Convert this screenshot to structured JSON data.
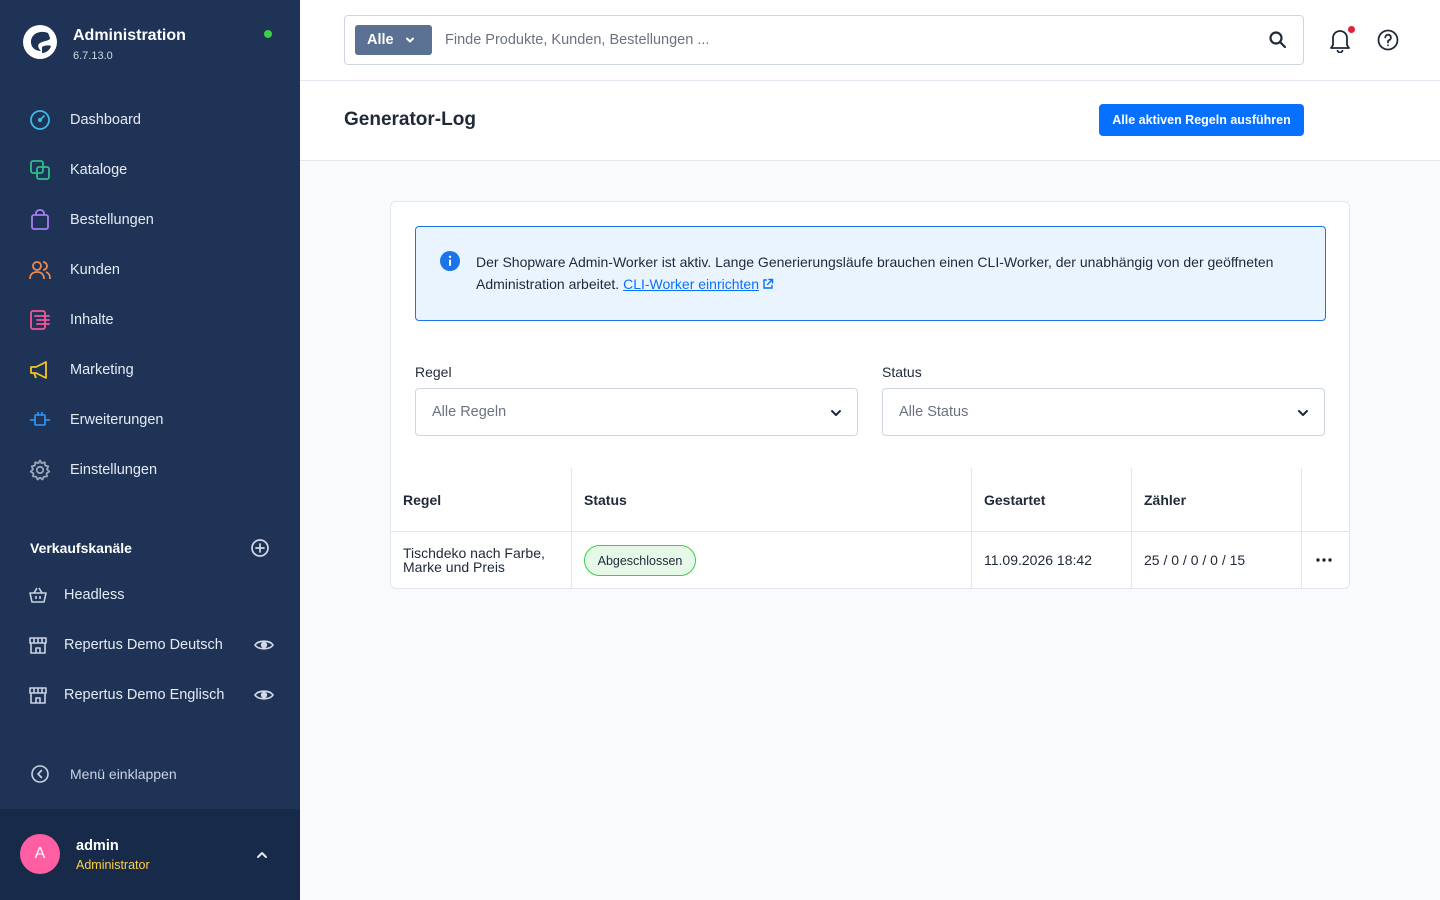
{
  "brand": {
    "title": "Administration",
    "version": "6.7.13.0"
  },
  "nav": [
    {
      "label": "Dashboard",
      "icon": "dashboard-icon",
      "color": "#3fb8e0"
    },
    {
      "label": "Kataloge",
      "icon": "catalog-icon",
      "color": "#2ebf8a"
    },
    {
      "label": "Bestellungen",
      "icon": "shopping-bag-icon",
      "color": "#a57ef0"
    },
    {
      "label": "Kunden",
      "icon": "customers-icon",
      "color": "#f08a4b"
    },
    {
      "label": "Inhalte",
      "icon": "content-icon",
      "color": "#f0589a"
    },
    {
      "label": "Marketing",
      "icon": "megaphone-icon",
      "color": "#f5c61a"
    },
    {
      "label": "Erweiterungen",
      "icon": "plug-icon",
      "color": "#2f8fe8"
    },
    {
      "label": "Einstellungen",
      "icon": "gear-icon",
      "color": "#9aa7b8"
    }
  ],
  "sales_channels": {
    "title": "Verkaufskanäle",
    "items": [
      {
        "label": "Headless",
        "icon": "basket-icon"
      },
      {
        "label": "Repertus Demo Deutsch",
        "icon": "storefront-icon"
      },
      {
        "label": "Repertus Demo Englisch",
        "icon": "storefront-icon"
      }
    ]
  },
  "collapse_label": "Menü einklappen",
  "user": {
    "initial": "A",
    "name": "admin",
    "role": "Administrator"
  },
  "search": {
    "type": "Alle",
    "placeholder": "Finde Produkte, Kunden, Bestellungen ..."
  },
  "page": {
    "title": "Generator-Log",
    "action_label": "Alle aktiven Regeln ausführen"
  },
  "alert": {
    "text": "Der Shopware Admin-Worker ist aktiv. Lange Generierungsläufe brauchen einen CLI-Worker, der unabhängig von der geöffneten Administration arbeitet.",
    "link": "CLI-Worker einrichten"
  },
  "filters": {
    "rule": {
      "label": "Regel",
      "value": "Alle Regeln"
    },
    "status": {
      "label": "Status",
      "value": "Alle Status"
    }
  },
  "table": {
    "columns": [
      "Regel",
      "Status",
      "Gestartet",
      "Zähler"
    ],
    "rows": [
      {
        "rule": "Tischdeko nach Farbe, Marke und Preis",
        "status": "Abgeschlossen",
        "started": "11.09.2026 18:42",
        "counter": "25 / 0 / 0 / 0 / 15"
      }
    ]
  }
}
